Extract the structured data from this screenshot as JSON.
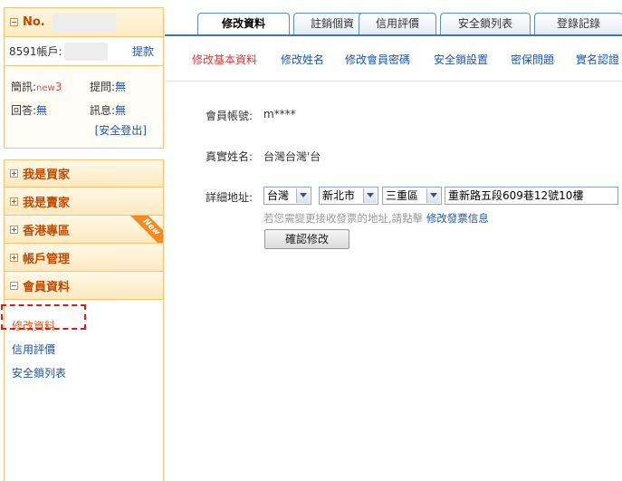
{
  "member_panel": {
    "title": "No.",
    "account_label": "8591帳戶:",
    "withdraw": "提款",
    "stats": [
      {
        "label": "簡訊:",
        "badge": "new",
        "value": "3"
      },
      {
        "label": "提問:",
        "value": "無"
      },
      {
        "label": "回答:",
        "value": "無"
      },
      {
        "label": "訊息:",
        "value": "無"
      }
    ],
    "logout": "[安全登出]"
  },
  "menu": {
    "items": [
      {
        "label": "我是買家"
      },
      {
        "label": "我是賣家"
      },
      {
        "label": "香港專區",
        "ribbon": "New"
      },
      {
        "label": "帳戶管理"
      },
      {
        "label": "會員資料"
      }
    ],
    "submenu": [
      "修改資料",
      "信用評價",
      "安全鎖列表"
    ]
  },
  "tabs": [
    "修改資料",
    "註銷個資",
    "信用評價",
    "安全鎖列表",
    "登錄記錄"
  ],
  "subnav": [
    "修改基本資料",
    "修改姓名",
    "修改會員密碼",
    "安全鎖設置",
    "密保問題",
    "實名認證"
  ],
  "form": {
    "account_label": "會員帳號:",
    "account_value": "m****",
    "name_label": "真實姓名:",
    "name_value": "台灣台灣'台",
    "address_label": "詳細地址:",
    "country": "台灣",
    "city": "新北市",
    "district": "三重區",
    "address": "重新路五段609巷12號10樓",
    "hint": "若您需變更接收發票的地址,請點擊",
    "hint_link": "修改發票信息",
    "confirm": "確認修改"
  },
  "colors": {
    "accent_orange": "#c04a00",
    "link_blue": "#1a55b0",
    "active_red": "#d43b3b",
    "tab_blue": "#3f74b0"
  }
}
